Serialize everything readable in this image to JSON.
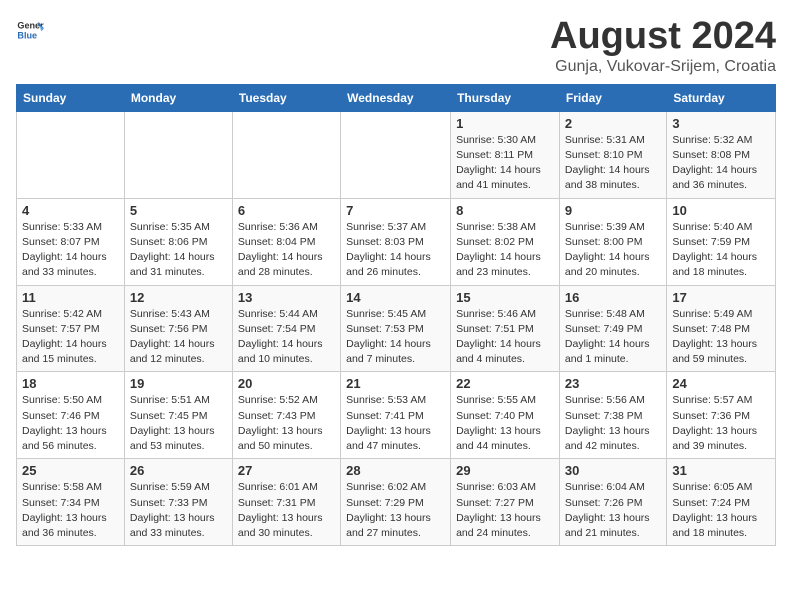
{
  "header": {
    "logo_general": "General",
    "logo_blue": "Blue",
    "title": "August 2024",
    "subtitle": "Gunja, Vukovar-Srijem, Croatia"
  },
  "calendar": {
    "weekdays": [
      "Sunday",
      "Monday",
      "Tuesday",
      "Wednesday",
      "Thursday",
      "Friday",
      "Saturday"
    ],
    "weeks": [
      [
        {
          "day": "",
          "info": ""
        },
        {
          "day": "",
          "info": ""
        },
        {
          "day": "",
          "info": ""
        },
        {
          "day": "",
          "info": ""
        },
        {
          "day": "1",
          "info": "Sunrise: 5:30 AM\nSunset: 8:11 PM\nDaylight: 14 hours\nand 41 minutes."
        },
        {
          "day": "2",
          "info": "Sunrise: 5:31 AM\nSunset: 8:10 PM\nDaylight: 14 hours\nand 38 minutes."
        },
        {
          "day": "3",
          "info": "Sunrise: 5:32 AM\nSunset: 8:08 PM\nDaylight: 14 hours\nand 36 minutes."
        }
      ],
      [
        {
          "day": "4",
          "info": "Sunrise: 5:33 AM\nSunset: 8:07 PM\nDaylight: 14 hours\nand 33 minutes."
        },
        {
          "day": "5",
          "info": "Sunrise: 5:35 AM\nSunset: 8:06 PM\nDaylight: 14 hours\nand 31 minutes."
        },
        {
          "day": "6",
          "info": "Sunrise: 5:36 AM\nSunset: 8:04 PM\nDaylight: 14 hours\nand 28 minutes."
        },
        {
          "day": "7",
          "info": "Sunrise: 5:37 AM\nSunset: 8:03 PM\nDaylight: 14 hours\nand 26 minutes."
        },
        {
          "day": "8",
          "info": "Sunrise: 5:38 AM\nSunset: 8:02 PM\nDaylight: 14 hours\nand 23 minutes."
        },
        {
          "day": "9",
          "info": "Sunrise: 5:39 AM\nSunset: 8:00 PM\nDaylight: 14 hours\nand 20 minutes."
        },
        {
          "day": "10",
          "info": "Sunrise: 5:40 AM\nSunset: 7:59 PM\nDaylight: 14 hours\nand 18 minutes."
        }
      ],
      [
        {
          "day": "11",
          "info": "Sunrise: 5:42 AM\nSunset: 7:57 PM\nDaylight: 14 hours\nand 15 minutes."
        },
        {
          "day": "12",
          "info": "Sunrise: 5:43 AM\nSunset: 7:56 PM\nDaylight: 14 hours\nand 12 minutes."
        },
        {
          "day": "13",
          "info": "Sunrise: 5:44 AM\nSunset: 7:54 PM\nDaylight: 14 hours\nand 10 minutes."
        },
        {
          "day": "14",
          "info": "Sunrise: 5:45 AM\nSunset: 7:53 PM\nDaylight: 14 hours\nand 7 minutes."
        },
        {
          "day": "15",
          "info": "Sunrise: 5:46 AM\nSunset: 7:51 PM\nDaylight: 14 hours\nand 4 minutes."
        },
        {
          "day": "16",
          "info": "Sunrise: 5:48 AM\nSunset: 7:49 PM\nDaylight: 14 hours\nand 1 minute."
        },
        {
          "day": "17",
          "info": "Sunrise: 5:49 AM\nSunset: 7:48 PM\nDaylight: 13 hours\nand 59 minutes."
        }
      ],
      [
        {
          "day": "18",
          "info": "Sunrise: 5:50 AM\nSunset: 7:46 PM\nDaylight: 13 hours\nand 56 minutes."
        },
        {
          "day": "19",
          "info": "Sunrise: 5:51 AM\nSunset: 7:45 PM\nDaylight: 13 hours\nand 53 minutes."
        },
        {
          "day": "20",
          "info": "Sunrise: 5:52 AM\nSunset: 7:43 PM\nDaylight: 13 hours\nand 50 minutes."
        },
        {
          "day": "21",
          "info": "Sunrise: 5:53 AM\nSunset: 7:41 PM\nDaylight: 13 hours\nand 47 minutes."
        },
        {
          "day": "22",
          "info": "Sunrise: 5:55 AM\nSunset: 7:40 PM\nDaylight: 13 hours\nand 44 minutes."
        },
        {
          "day": "23",
          "info": "Sunrise: 5:56 AM\nSunset: 7:38 PM\nDaylight: 13 hours\nand 42 minutes."
        },
        {
          "day": "24",
          "info": "Sunrise: 5:57 AM\nSunset: 7:36 PM\nDaylight: 13 hours\nand 39 minutes."
        }
      ],
      [
        {
          "day": "25",
          "info": "Sunrise: 5:58 AM\nSunset: 7:34 PM\nDaylight: 13 hours\nand 36 minutes."
        },
        {
          "day": "26",
          "info": "Sunrise: 5:59 AM\nSunset: 7:33 PM\nDaylight: 13 hours\nand 33 minutes."
        },
        {
          "day": "27",
          "info": "Sunrise: 6:01 AM\nSunset: 7:31 PM\nDaylight: 13 hours\nand 30 minutes."
        },
        {
          "day": "28",
          "info": "Sunrise: 6:02 AM\nSunset: 7:29 PM\nDaylight: 13 hours\nand 27 minutes."
        },
        {
          "day": "29",
          "info": "Sunrise: 6:03 AM\nSunset: 7:27 PM\nDaylight: 13 hours\nand 24 minutes."
        },
        {
          "day": "30",
          "info": "Sunrise: 6:04 AM\nSunset: 7:26 PM\nDaylight: 13 hours\nand 21 minutes."
        },
        {
          "day": "31",
          "info": "Sunrise: 6:05 AM\nSunset: 7:24 PM\nDaylight: 13 hours\nand 18 minutes."
        }
      ]
    ]
  }
}
